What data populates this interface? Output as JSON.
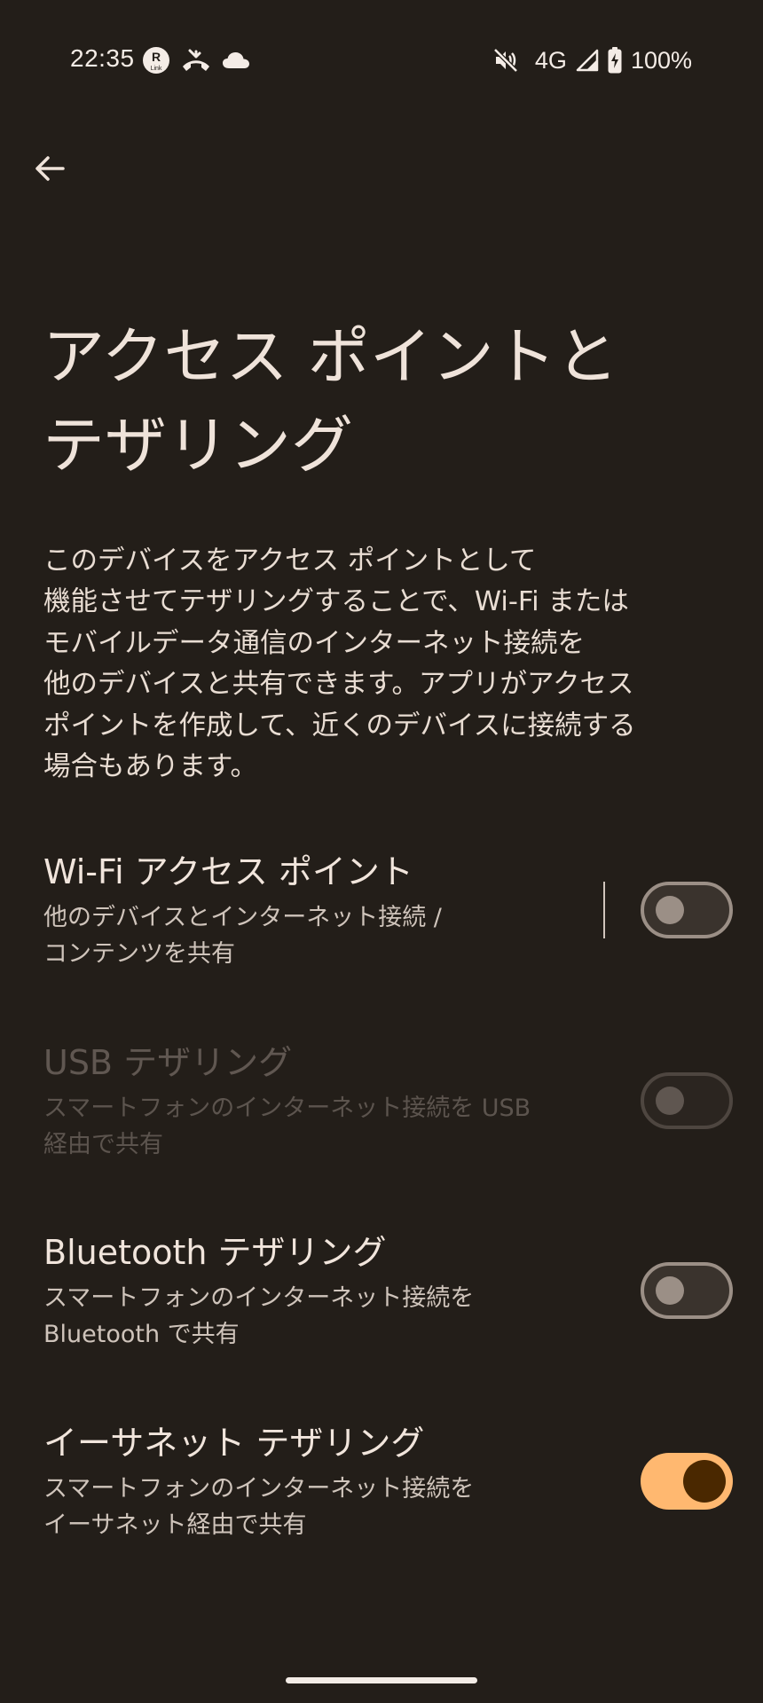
{
  "status_bar": {
    "time": "22:35",
    "left_icons": [
      "rakuten-link-icon",
      "missed-call-icon",
      "cloud-icon"
    ],
    "right_icons": [
      "mute-icon",
      "signal-icon",
      "battery-charging-icon"
    ],
    "network": "4G",
    "battery": "100%"
  },
  "header": {
    "back_icon": "arrow-back-icon"
  },
  "page": {
    "title_line1": "アクセス ポイントと",
    "title_line2": "テザリング",
    "description_lines": [
      "このデバイスをアクセス ポイントとして",
      "機能させてテザリングすることで、Wi-Fi または",
      "モバイルデータ通信のインターネット接続を",
      "他のデバイスと共有できます。アプリがアクセス",
      "ポイントを作成して、近くのデバイスに接続する",
      "場合もあります。"
    ]
  },
  "settings": [
    {
      "title": "Wi-Fi アクセス ポイント",
      "summary_line1": "他のデバイスとインターネット接続 /",
      "summary_line2": "コンテンツを共有",
      "enabled": true,
      "checked": false
    },
    {
      "title": "USB テザリング",
      "summary_line1": "スマートフォンのインターネット接続を USB",
      "summary_line2": "経由で共有",
      "enabled": false,
      "checked": false
    },
    {
      "title": "Bluetooth テザリング",
      "summary_line1": "スマートフォンのインターネット接続を",
      "summary_line2": "Bluetooth で共有",
      "enabled": true,
      "checked": false
    },
    {
      "title": "イーサネット テザリング",
      "summary_line1": "スマートフォンのインターネット接続を",
      "summary_line2": "イーサネット経由で共有",
      "enabled": true,
      "checked": true
    }
  ],
  "colors": {
    "background": "#231e19",
    "accent": "#ffb870",
    "accent_thumb": "#4a2800",
    "text_primary": "#f1e5dc",
    "text_secondary": "#cfc4bb"
  }
}
